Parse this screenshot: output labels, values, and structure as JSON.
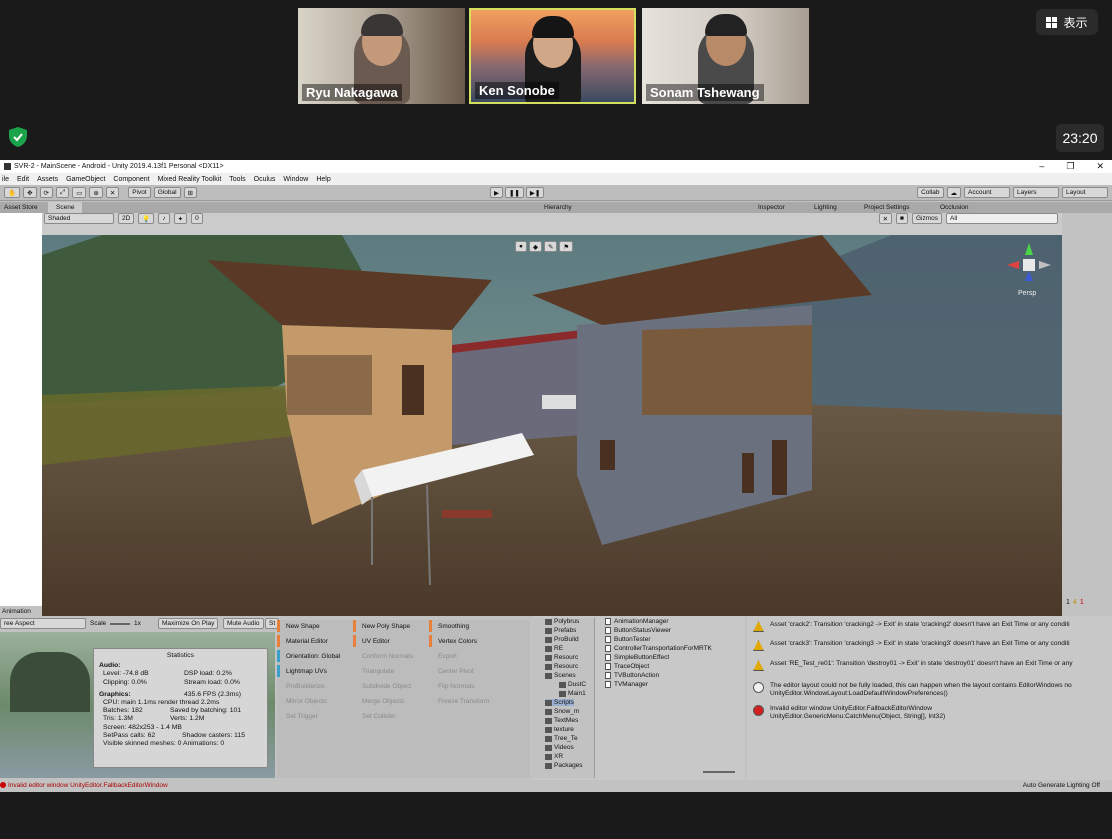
{
  "meeting": {
    "participants": [
      {
        "name": "Ryu Nakagawa",
        "active": false
      },
      {
        "name": "Ken Sonobe",
        "active": true
      },
      {
        "name": "Sonam Tshewang",
        "active": false
      }
    ],
    "show_button": "表示",
    "clock": "23:20",
    "colors": {
      "active_border": "#d6e060",
      "shield": "#1aa34a"
    }
  },
  "unity": {
    "title": "SVR-2 - MainScene - Android - Unity 2019.4.13f1 Personal <DX11>",
    "menu": [
      "ile",
      "Edit",
      "Assets",
      "GameObject",
      "Component",
      "Mixed Reality Toolkit",
      "Tools",
      "Oculus",
      "Window",
      "Help"
    ],
    "toolbar": {
      "pivot": "Pivot",
      "global": "Global",
      "collab": "Collab",
      "account": "Account",
      "layers": "Layers",
      "layout": "Layout"
    },
    "tabs": {
      "asset_store": "Asset Store",
      "scene": "Scene",
      "hierarchy": "Hierarchy",
      "inspector": "Inspector",
      "lighting": "Lighting",
      "project_settings": "Project Settings",
      "occlusion": "Occlusion"
    },
    "scene_bar": {
      "shaded": "Shaded",
      "mode2d": "2D",
      "gizmos": "Gizmos",
      "search": "All",
      "persp": "Persp",
      "layers_count": "0"
    },
    "animation": {
      "tab": "Animation",
      "aspect": "ree Aspect",
      "scale": "Scale",
      "scale_value": "1x",
      "maximize": "Maximize On Play",
      "mute": "Mute Audio",
      "stats_short": "St"
    },
    "statistics": {
      "title": "Statistics",
      "audio_header": "Audio:",
      "level": "Level: -74.8 dB",
      "clipping": "Clipping: 0.0%",
      "dsp": "DSP load: 0.2%",
      "stream": "Stream load: 0.0%",
      "graphics_header": "Graphics:",
      "fps": "435.6 FPS (2.3ms)",
      "cpu": "CPU: main 1.1ms  render thread 2.2ms",
      "batches": "Batches: 182",
      "saved_batching": "Saved by batching: 101",
      "tris": "Tris: 1.3M",
      "verts": "Verts: 1.2M",
      "screen": "Screen: 482x253 - 1.4 MB",
      "setpass": "SetPass calls: 62",
      "shadow_casters": "Shadow casters: 115",
      "skinned": "Visible skinned meshes: 0  Animations: 0"
    },
    "probuilder": [
      {
        "label": "New Shape",
        "color": "#e87f3a",
        "enabled": true
      },
      {
        "label": "New Poly Shape",
        "color": "#e87f3a",
        "enabled": true
      },
      {
        "label": "Smoothing",
        "color": "#e87f3a",
        "enabled": true
      },
      {
        "label": "Material Editor",
        "color": "#e87f3a",
        "enabled": true
      },
      {
        "label": "UV Editor",
        "color": "#e87f3a",
        "enabled": true
      },
      {
        "label": "Vertex Colors",
        "color": "#e87f3a",
        "enabled": true
      },
      {
        "label": "Orientation: Global",
        "color": "#3aa0c8",
        "enabled": true
      },
      {
        "label": "Conform Normals",
        "color": "",
        "enabled": false
      },
      {
        "label": "Export",
        "color": "",
        "enabled": false
      },
      {
        "label": "Lightmap UVs",
        "color": "#3aa0c8",
        "enabled": true
      },
      {
        "label": "Triangulate",
        "color": "",
        "enabled": false
      },
      {
        "label": "Center Pivot",
        "color": "",
        "enabled": false
      },
      {
        "label": "ProBuilderize",
        "color": "",
        "enabled": false
      },
      {
        "label": "Subdivide Object",
        "color": "",
        "enabled": false
      },
      {
        "label": "Flip Normals",
        "color": "",
        "enabled": false
      },
      {
        "label": "Mirror Objects",
        "color": "",
        "enabled": false
      },
      {
        "label": "Merge Objects",
        "color": "",
        "enabled": false
      },
      {
        "label": "Freeze Transform",
        "color": "",
        "enabled": false
      },
      {
        "label": "Set Trigger",
        "color": "",
        "enabled": false
      },
      {
        "label": "Set Collider",
        "color": "",
        "enabled": false
      }
    ],
    "project_tree": [
      "Polybrus",
      "Prefabs",
      "ProBuild",
      "RE",
      "Resourc",
      "Resourc",
      "Scenes",
      "DustC",
      "Main1",
      "Scripts",
      "Snow_m",
      "TextMes",
      "texture",
      "Tree_Te",
      "Videos",
      "XR",
      "Packages"
    ],
    "project_files": [
      "AnimationManager",
      "ButtonStatusViewer",
      "ButtonTester",
      "ControllerTransportationForMRTK",
      "SimpleButtonEffect",
      "TraceObject",
      "TVButtonAction",
      "TVManager"
    ],
    "console": {
      "counts": {
        "info": "1",
        "warn": "4",
        "error": "1"
      },
      "messages": [
        {
          "type": "warn",
          "text": "Asset 'crack2': Transition 'cracking2 -> Exit' in state 'cracking2' doesn't have an Exit Time or any conditi"
        },
        {
          "type": "warn",
          "text": "Asset 'crack3': Transition 'cracking3 -> Exit' in state 'cracking3' doesn't have an Exit Time or any conditi"
        },
        {
          "type": "warn",
          "text": "Asset 'RE_Test_re01': Transition 'destroy01 -> Exit' in state 'destroy01' doesn't have an Exit Time or any"
        },
        {
          "type": "info",
          "text": "The editor layout could not be fully loaded, this can happen when the layout contains EditorWindows no",
          "text2": "UnityEditor.WindowLayout:LoadDefaultWindowPreferences()"
        },
        {
          "type": "error",
          "text": "Invalid editor window UnityEditor.FallbackEditorWindow",
          "text2": "UnityEditor.GenericMenu:CatchMenu(Object, String[], Int32)"
        }
      ]
    },
    "status_left": "Invalid editor window UnityEditor.FallbackEditorWindow",
    "status_right": "Auto Generate Lighting Off"
  }
}
